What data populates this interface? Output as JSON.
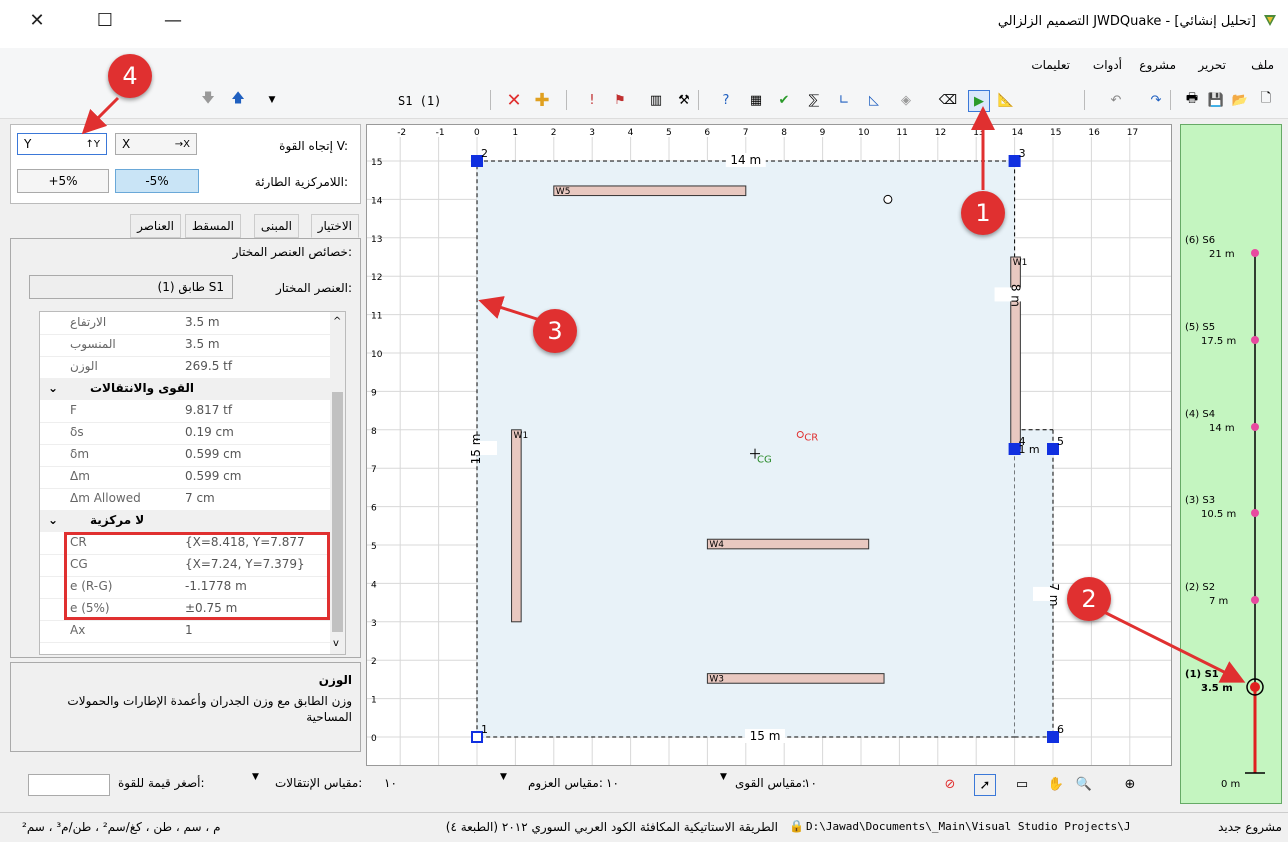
{
  "window": {
    "title": "التصميم الزلزالي JWDQuake - [تحليل إنشائي]"
  },
  "menu": [
    "ملف",
    "تحرير",
    "مشروع",
    "أدوات",
    "تعليمات"
  ],
  "toolbar": {
    "story_combo": "S1 (1)"
  },
  "force_panel": {
    "dir_label": "إتجاه القوة V:",
    "dir_y": "Y",
    "dir_x": "X",
    "ecc_label": "اللامركزية الطارئة:",
    "minus5": "-5%",
    "plus5": "+5%"
  },
  "tabs": [
    "الاختيار",
    "المبنى",
    "المسقط",
    "العناصر"
  ],
  "props": {
    "group_title": "خصائص العنصر المختار:",
    "selected_label": "العنصر المختار:",
    "selected_value": "طابق (1) S1",
    "rows": [
      {
        "k": "الارتفاع",
        "v": "3.5 m"
      },
      {
        "k": "المنسوب",
        "v": "3.5 m"
      },
      {
        "k": "الوزن",
        "v": "269.5 tf"
      }
    ],
    "cat_forces": "القوى والانتقالات",
    "force_rows": [
      {
        "k": "F",
        "v": "9.817 tf"
      },
      {
        "k": "δs",
        "v": "0.19 cm"
      },
      {
        "k": "δm",
        "v": "0.599 cm"
      },
      {
        "k": "Δm",
        "v": "0.599 cm"
      },
      {
        "k": "Δm Allowed",
        "v": "7 cm"
      }
    ],
    "cat_ecc": "لا مركزية",
    "ecc_rows": [
      {
        "k": "CR",
        "v": "{X=8.418, Y=7.877"
      },
      {
        "k": "CG",
        "v": "{X=7.24, Y=7.379}"
      },
      {
        "k": "e (R-G)",
        "v": "-1.1778 m"
      },
      {
        "k": "e (5%)",
        "v": "±0.75 m"
      }
    ],
    "last_row": {
      "k": "Ax",
      "v": "1"
    }
  },
  "description": {
    "title": "الوزن",
    "text": "وزن الطابق مع وزن الجدران وأعمدة الإطارات والحمولات المساحية"
  },
  "plan": {
    "xticks": [
      "-2",
      "-1",
      "0",
      "1",
      "2",
      "3",
      "4",
      "5",
      "6",
      "7",
      "8",
      "9",
      "10",
      "11",
      "12",
      "13",
      "14",
      "15",
      "16",
      "17"
    ],
    "yticks": [
      "15",
      "14",
      "13",
      "12",
      "11",
      "10",
      "9",
      "8",
      "7",
      "6",
      "5",
      "4",
      "3",
      "2",
      "1",
      "0"
    ],
    "dim_top": "14 m",
    "dim_bottom": "15 m",
    "dim_left": "15 m",
    "dim_right": "8 m",
    "dim_right2": "7 m",
    "dim_small": "1 m",
    "walls": [
      "W5",
      "W4",
      "W3",
      "W1",
      "W1"
    ],
    "cr_label": "CR",
    "cg_label": "CG",
    "nodes": [
      "1",
      "2",
      "3",
      "4",
      "5",
      "6"
    ]
  },
  "stories": [
    {
      "name": "(6) S6",
      "elev": "21 m"
    },
    {
      "name": "(5) S5",
      "elev": "17.5 m"
    },
    {
      "name": "(4) S4",
      "elev": "14 m"
    },
    {
      "name": "(3) S3",
      "elev": "10.5 m"
    },
    {
      "name": "(2) S2",
      "elev": "7 m"
    },
    {
      "name": "(1) S1",
      "elev": "3.5 m"
    },
    {
      "name": "",
      "elev": "0 m"
    }
  ],
  "bottom": {
    "min_force_label": "أصغر قيمة للقوة:",
    "disp_scale_label": "مقياس الإنتقالات:",
    "disp_scale_val": "١٠",
    "moment_scale_label": "مقياس العزوم:",
    "moment_scale_val": "١٠",
    "force_scale_label": "مقياس القوى:",
    "force_scale_val": "١٠"
  },
  "status": {
    "project": "مشروع جديد",
    "path": "D:\\Jawad\\Documents\\_Main\\Visual Studio Projects\\J",
    "method": "الطريقة الاستاتيكية المكافئة  الكود العربي السوري ٢٠١٢ (الطبعة ٤)",
    "units": "م ، سم ، طن ، كغ/سم² ، طن/م³ ، سم²"
  },
  "callouts": [
    "1",
    "2",
    "3",
    "4"
  ],
  "colors": {
    "accent": "#1a5fc8",
    "highlight": "#e03030",
    "plan_fill": "#e8f2f8",
    "story_panel": "#c4f5c0"
  }
}
